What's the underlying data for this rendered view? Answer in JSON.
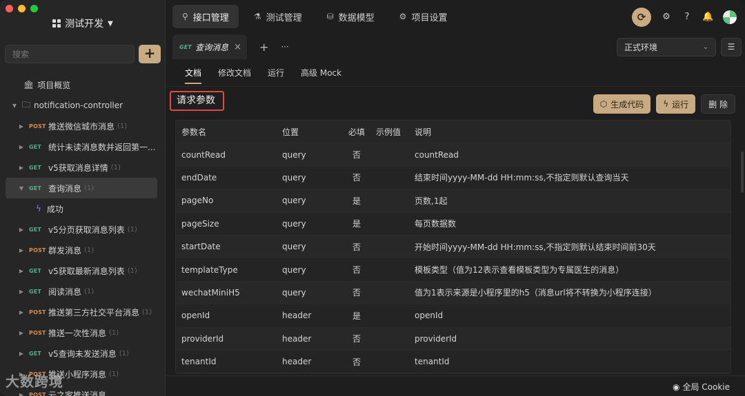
{
  "window": {
    "traffic_colors": [
      "#fe5f57",
      "#febc2e",
      "#28c840"
    ]
  },
  "sidebar": {
    "project_name": "测试开发",
    "search_placeholder": "搜索",
    "add_label": "+",
    "overview_label": "项目概览",
    "folder_label": "notification-controller",
    "items": [
      {
        "method": "POST",
        "label": "推送微信城市消息",
        "count": "(1)"
      },
      {
        "method": "GET",
        "label": "统计未读消息数并返回第一...",
        "count": ""
      },
      {
        "method": "GET",
        "label": "v5获取消息详情",
        "count": "(1)"
      },
      {
        "method": "GET",
        "label": "查询消息",
        "count": "(1)",
        "selected": true
      },
      {
        "method": "GET",
        "label": "v5分页获取消息列表",
        "count": "(1)"
      },
      {
        "method": "POST",
        "label": "群发消息",
        "count": "(1)"
      },
      {
        "method": "GET",
        "label": "v5获取最新消息列表",
        "count": "(1)"
      },
      {
        "method": "GET",
        "label": "阅读消息",
        "count": "(1)"
      },
      {
        "method": "POST",
        "label": "推送第三方社交平台消息",
        "count": "(1)"
      },
      {
        "method": "POST",
        "label": "推送一次性消息",
        "count": "(1)"
      },
      {
        "method": "GET",
        "label": "v5查询未发送消息",
        "count": "(1)"
      },
      {
        "method": "POST",
        "label": "推送小程序消息",
        "count": "(1)"
      },
      {
        "method": "POST",
        "label": "云之家推送消息",
        "count": ""
      }
    ],
    "sub_item_label": "成功"
  },
  "topnav": {
    "tabs": [
      {
        "label": "接口管理",
        "icon": "rocket-icon",
        "active": true
      },
      {
        "label": "测试管理",
        "icon": "flask-icon"
      },
      {
        "label": "数据模型",
        "icon": "model-icon"
      },
      {
        "label": "项目设置",
        "icon": "gear-icon"
      }
    ]
  },
  "tabbar": {
    "open_tab": {
      "method": "GET",
      "label": "查询消息"
    },
    "add_label": "+",
    "more_label": "···",
    "env_label": "正式环境"
  },
  "subtabs": [
    "文档",
    "修改文档",
    "运行",
    "高级 Mock"
  ],
  "section": {
    "title": "请求参数",
    "gen_code_label": "生成代码",
    "run_label": "运行",
    "delete_label": "删 除"
  },
  "table": {
    "headers": [
      "参数名",
      "位置",
      "必填",
      "示例值",
      "说明"
    ],
    "rows": [
      [
        "countRead",
        "query",
        "否",
        "",
        "countRead"
      ],
      [
        "endDate",
        "query",
        "否",
        "",
        "结束时间yyyy-MM-dd HH:mm:ss,不指定则默认查询当天"
      ],
      [
        "pageNo",
        "query",
        "是",
        "",
        "页数,1起"
      ],
      [
        "pageSize",
        "query",
        "是",
        "",
        "每页数据数"
      ],
      [
        "startDate",
        "query",
        "否",
        "",
        "开始时间yyyy-MM-dd HH:mm:ss,不指定则默认结束时间前30天"
      ],
      [
        "templateType",
        "query",
        "否",
        "",
        "模板类型（值为12表示查看模板类型为专属医生的消息）"
      ],
      [
        "wechatMiniH5",
        "query",
        "否",
        "",
        "值为1表示来源是小程序里的h5（消息url将不转换为小程序连接）"
      ],
      [
        "openId",
        "header",
        "是",
        "",
        "openId"
      ],
      [
        "providerId",
        "header",
        "否",
        "",
        "providerId"
      ],
      [
        "tenantId",
        "header",
        "否",
        "",
        "tenantId"
      ]
    ]
  },
  "footer": {
    "cookie_label": "全局 Cookie"
  },
  "watermark": "大数跨境",
  "colors": {
    "accent": "#c9ab83",
    "get": "#4db38a",
    "post": "#e08a4c",
    "highlight_border": "#e04a3c"
  }
}
